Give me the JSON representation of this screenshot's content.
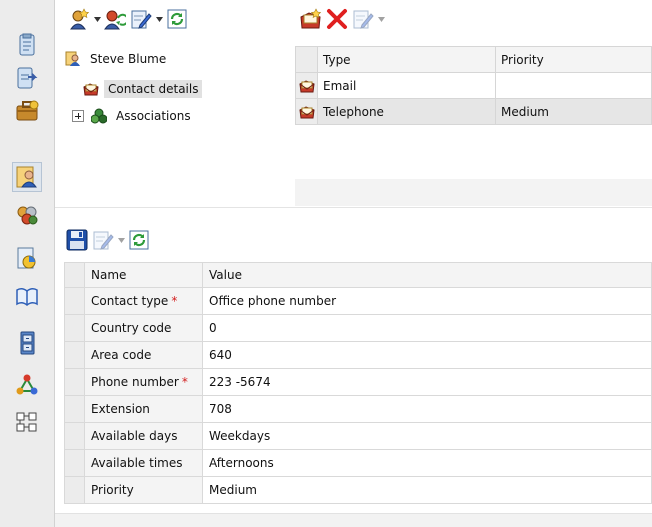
{
  "leftbar": {
    "items": [
      {
        "icon": "document-icon"
      },
      {
        "icon": "document-arrow-icon"
      },
      {
        "icon": "briefcase-icon"
      },
      {
        "icon": "person-card-icon",
        "active": true
      },
      {
        "icon": "people-group-icon"
      },
      {
        "icon": "report-chart-icon"
      },
      {
        "icon": "book-icon"
      },
      {
        "icon": "cabinet-icon"
      },
      {
        "icon": "hierarchy-icon"
      },
      {
        "icon": "workflow-icon"
      }
    ]
  },
  "tree_toolbar": {
    "buttons": [
      "new-contact-icon",
      "contact-refresh-icon",
      "edit-icon",
      "refresh-icon"
    ]
  },
  "tree": {
    "root": "Steve Blume",
    "selected": "Contact details",
    "collapsed": "Associations"
  },
  "methods_toolbar": {
    "buttons": [
      "new-method-icon",
      "delete-icon",
      "edit-icon"
    ]
  },
  "methods_grid": {
    "columns": [
      "Type",
      "Priority"
    ],
    "rows": [
      {
        "type": "Email",
        "priority": ""
      },
      {
        "type": "Telephone",
        "priority": "Medium"
      }
    ]
  },
  "details_toolbar": {
    "buttons": [
      "save-icon",
      "edit-icon",
      "refresh-icon"
    ]
  },
  "property_grid": {
    "columns": [
      "Name",
      "Value"
    ],
    "rows": [
      {
        "name": "Contact type",
        "value": "Office phone number",
        "required": "*"
      },
      {
        "name": "Country code",
        "value": "0",
        "required": ""
      },
      {
        "name": "Area code",
        "value": "640",
        "required": ""
      },
      {
        "name": "Phone number",
        "value": "223 -5674",
        "required": "*"
      },
      {
        "name": "Extension",
        "value": "708",
        "required": ""
      },
      {
        "name": "Available days",
        "value": "Weekdays",
        "required": ""
      },
      {
        "name": "Available times",
        "value": "Afternoons",
        "required": ""
      },
      {
        "name": "Priority",
        "value": "Medium",
        "required": ""
      }
    ]
  },
  "colors": {
    "accent_red": "#d21d1d",
    "save_blue": "#1f4fa8",
    "refresh_green": "#2e9b3a"
  }
}
